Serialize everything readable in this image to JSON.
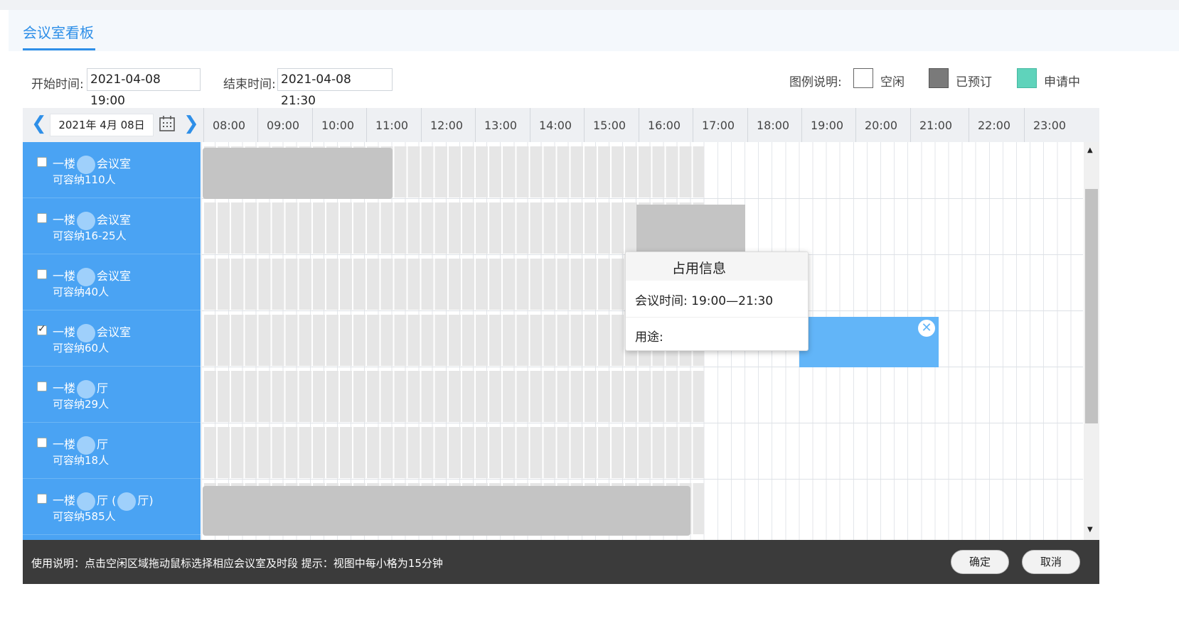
{
  "header": {
    "title": "会议室看板"
  },
  "toolbar": {
    "start_label": "开始时间:",
    "start_value": "2021-04-08 19:00",
    "end_label": "结束时间:",
    "end_value": "2021-04-08 21:30",
    "legend_label": "图例说明:",
    "legend": [
      {
        "label": "空闲",
        "color": "#ffffff"
      },
      {
        "label": "已预订",
        "color": "#7a7a7a"
      },
      {
        "label": "申请中",
        "color": "#5fd3bb"
      }
    ]
  },
  "date_nav": {
    "date": "2021年 4月 08日",
    "prev_icon": "chevron-left-icon",
    "next_icon": "chevron-right-icon",
    "calendar_icon": "calendar-icon"
  },
  "hours": [
    "08:00",
    "09:00",
    "10:00",
    "11:00",
    "12:00",
    "13:00",
    "14:00",
    "15:00",
    "16:00",
    "17:00",
    "18:00",
    "19:00",
    "20:00",
    "21:00",
    "22:00",
    "23:00"
  ],
  "rooms": [
    {
      "name": "一楼",
      "name_suffix": "会议室",
      "capacity": "可容纳110人",
      "checked": false
    },
    {
      "name": "一楼",
      "name_suffix": "会议室",
      "capacity": "可容纳16-25人",
      "checked": false
    },
    {
      "name": "一楼",
      "name_suffix": "会议室",
      "capacity": "可容纳40人",
      "checked": false
    },
    {
      "name": "一楼",
      "name_suffix": "会议室",
      "capacity": "可容纳60人",
      "checked": true
    },
    {
      "name": "一楼",
      "name_suffix": "厅",
      "capacity": "可容纳29人",
      "checked": false
    },
    {
      "name": "一楼",
      "name_suffix": "厅",
      "capacity": "可容纳18人",
      "checked": false
    },
    {
      "name": "一楼",
      "name_suffix": "厅 (",
      "name_suffix2": "厅)",
      "capacity": "可容纳585人",
      "checked": false
    }
  ],
  "popup": {
    "title": "占用信息",
    "time_text": "会议时间: 19:00—21:30",
    "purpose_text": "用途:"
  },
  "footer": {
    "instructions": "使用说明：点击空闲区域拖动鼠标选择相应会议室及时段 提示：视图中每小格为15分钟",
    "confirm_label": "确定",
    "cancel_label": "取消"
  },
  "colors": {
    "accent": "#2e8fe8",
    "room_panel": "#4aa3f3",
    "selection": "#62b5f8"
  }
}
